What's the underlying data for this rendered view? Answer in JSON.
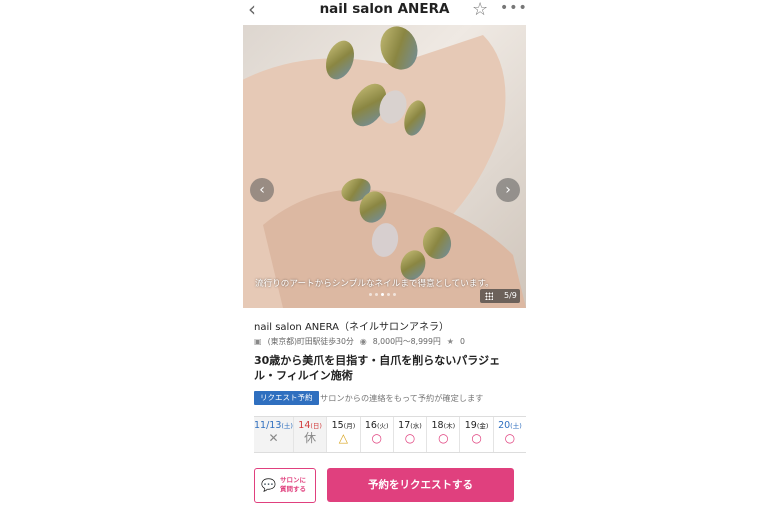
{
  "header": {
    "title": "nail salon  ANERA",
    "back_icon": "back-chevron-icon",
    "star_icon": "star-icon",
    "more_icon": "more-icon"
  },
  "photo": {
    "caption": "流行りのアートからシンプルなネイルまで得意としています。",
    "counter": "5/9",
    "pager_count": 5,
    "pager_active": 2
  },
  "salon": {
    "name": "nail salon  ANERA（ネイルサロンアネラ）",
    "access": "(東京都)町田駅徒歩30分",
    "price": "8,000円〜8,999円",
    "rating": "0"
  },
  "headline": "30歳から美爪を目指す・自爪を削らないパラジェル・フィルイン施術",
  "request": {
    "badge": "リクエスト予約",
    "note": "サロンからの連絡をもって予約が確定します"
  },
  "calendar": [
    {
      "date": "11/13",
      "dow": "(土)",
      "symbol": "✕",
      "date_color": "blue",
      "symbol_color": "gray"
    },
    {
      "date": "14",
      "dow": "(日)",
      "symbol": "休",
      "date_color": "red",
      "symbol_color": "gray"
    },
    {
      "date": "15",
      "dow": "(月)",
      "symbol": "△",
      "date_color": "dark",
      "symbol_color": "gold"
    },
    {
      "date": "16",
      "dow": "(火)",
      "symbol": "○",
      "date_color": "dark",
      "symbol_color": "pink"
    },
    {
      "date": "17",
      "dow": "(水)",
      "symbol": "○",
      "date_color": "dark",
      "symbol_color": "pink"
    },
    {
      "date": "18",
      "dow": "(木)",
      "symbol": "○",
      "date_color": "dark",
      "symbol_color": "pink"
    },
    {
      "date": "19",
      "dow": "(金)",
      "symbol": "○",
      "date_color": "dark",
      "symbol_color": "pink"
    },
    {
      "date": "20",
      "dow": "(土)",
      "symbol": "○",
      "date_color": "blue",
      "symbol_color": "pink"
    }
  ],
  "footer": {
    "ask_line1": "サロンに",
    "ask_line2": "質問する",
    "request_button": "予約をリクエストする"
  },
  "colors": {
    "accent": "#e0407e",
    "badge": "#2f6fbf"
  }
}
